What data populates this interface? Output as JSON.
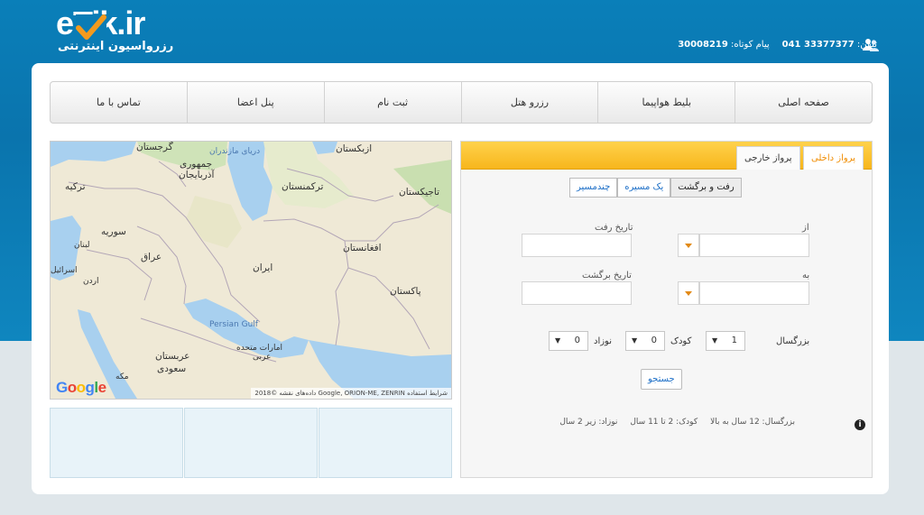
{
  "header": {
    "logo_text": "eTik.ir",
    "logo_subtitle": "رزرواسیون اینترنتی",
    "phone_label": "تلفن:",
    "phone_value": "041 33377377",
    "sms_label": "پیام کوتاه:",
    "sms_value": "30008219",
    "icon": "users-icon"
  },
  "nav": {
    "items": [
      {
        "label": "صفحه اصلی"
      },
      {
        "label": "بلیط هواپیما"
      },
      {
        "label": "رزرو هتل"
      },
      {
        "label": "ثبت نام"
      },
      {
        "label": "پنل اعضا"
      },
      {
        "label": "تماس با ما"
      }
    ]
  },
  "flight_form": {
    "tabs": {
      "domestic": "پرواز داخلی",
      "international": "پرواز خارجی"
    },
    "trip_types": {
      "round": "رفت و برگشت",
      "oneway": "یک مسیره",
      "multi": "چندمسیر"
    },
    "from_label": "از",
    "to_label": "به",
    "depart_label": "تاریخ رفت",
    "return_label": "تاریخ برگشت",
    "adult_label": "بزرگسال",
    "adult_value": "1",
    "child_label": "کودک",
    "child_value": "0",
    "infant_label": "نوزاد",
    "infant_value": "0",
    "search_label": "جستجو",
    "info": {
      "adult": "بزرگسال: 12 سال به بالا",
      "child": "کودک: 2 تا 11 سال",
      "infant": "نوزاد: زیر 2 سال"
    }
  },
  "map": {
    "labels": {
      "georgia": "گرجستان",
      "caspian": "دریای مازندران",
      "uzbekistan": "ازبکستان",
      "azerbaijan_line1": "جمهوری",
      "azerbaijan_line2": "آذربایجان",
      "turkey": "ترکیه",
      "turkmenistan": "ترکمنستان",
      "tajikistan": "تاجیکستان",
      "syria": "سوریه",
      "lebanon": "لبنان",
      "afghanistan": "افغانستان",
      "iraq": "عراق",
      "israel": "اسرائیل",
      "jordan": "اردن",
      "iran": "ایران",
      "pakistan": "پاکستان",
      "persian_gulf": "Persian Gulf",
      "uae_line1": "امارات متحده",
      "uae_line2": "عربی",
      "saudi_line1": "عربستان",
      "saudi_line2": "سعودی",
      "mecca": "مکه"
    },
    "google_logo": "Google",
    "attribution": "داده‌های نقشه ©2018 Google, ORION-ME, ZENRIN   شرایط استفاده"
  }
}
